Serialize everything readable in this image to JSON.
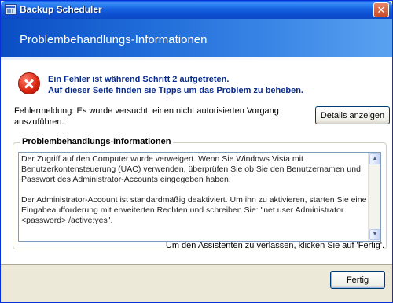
{
  "window": {
    "title": "Backup Scheduler",
    "close_glyph": "✕"
  },
  "banner": {
    "title": "Problembehandlungs-Informationen"
  },
  "error": {
    "icon": "error-x-icon",
    "heading_line1": "Ein Fehler ist während Schritt 2 aufgetreten.",
    "heading_line2": "Auf dieser Seite finden sie Tipps um das Problem zu beheben.",
    "message": "Fehlermeldung: Es wurde versucht, einen nicht autorisierten Vorgang auszuführen.",
    "details_button": "Details anzeigen"
  },
  "troubleshooting": {
    "group_label": "Problembehandlungs-Informationen",
    "paragraph1": "Der Zugriff auf den Computer wurde verweigert. Wenn Sie Windows Vista mit Benutzerkontensteuerung (UAC) verwenden, überprüfen Sie ob Sie den Benutzernamen und Passwort des Administrator-Accounts eingegeben haben.",
    "paragraph2": "Der Administrator-Account ist standardmäßig deaktiviert. Um ihn zu aktivieren, starten Sie eine Eingabeaufforderung mit erweiterten Rechten und schreiben Sie: \"net user Administrator <password> /active:yes\".",
    "scroll_up_glyph": "▲",
    "scroll_down_glyph": "▼"
  },
  "footer": {
    "hint": "Um den Assistenten zu verlassen, klicken Sie auf 'Fertig'.",
    "finish_button": "Fertig"
  },
  "colors": {
    "titlebar": "#0c4fd0",
    "banner": "#1e6ad8",
    "heading_text": "#0a2b8c",
    "window_bg": "#ece9d8"
  }
}
